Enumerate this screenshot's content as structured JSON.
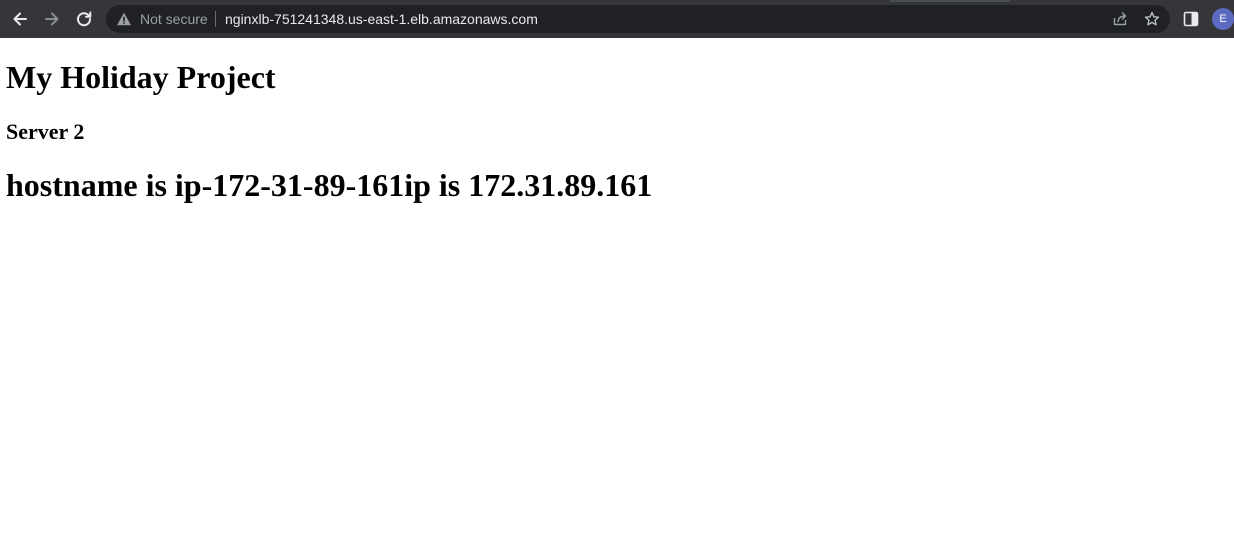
{
  "browser": {
    "security_label": "Not secure",
    "url": "nginxlb-751241348.us-east-1.elb.amazonaws.com",
    "profile_initial": "E",
    "icons": {
      "back": "back-arrow-icon",
      "forward": "forward-arrow-icon",
      "reload": "reload-icon",
      "warning": "warning-icon",
      "share": "share-icon",
      "bookmark": "star-icon",
      "side_panel": "side-panel-icon"
    },
    "colors": {
      "toolbar": "#35363a",
      "omnibox": "#202124",
      "avatar": "#5c6bc0"
    }
  },
  "page": {
    "title": "My Holiday Project",
    "subtitle": "Server 2",
    "host_info": "hostname is ip-172-31-89-161ip is 172.31.89.161"
  }
}
